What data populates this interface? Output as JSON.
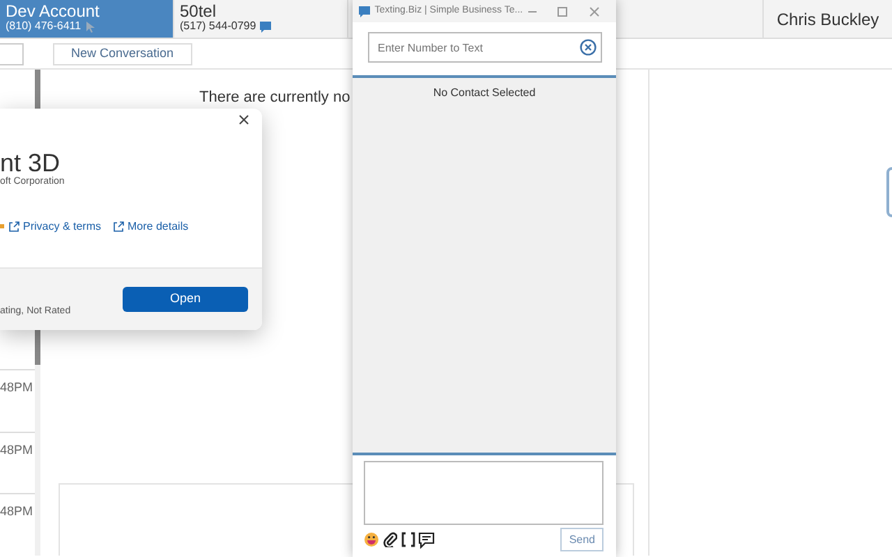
{
  "accounts": [
    {
      "name": "Dev Account",
      "phone": "(810) 476-6411",
      "selected": true
    },
    {
      "name": "50tel",
      "phone": "(517) 544-0799",
      "selected": false
    }
  ],
  "user": {
    "name": "Chris Buckley"
  },
  "toolbar": {
    "new_conversation": "New Conversation"
  },
  "conversation_list": [
    {
      "time": "48PM"
    },
    {
      "time": "48PM"
    },
    {
      "time": "48PM"
    }
  ],
  "empty_message": "There are currently no",
  "app_dialog": {
    "title": "nt 3D",
    "publisher": "oft Corporation",
    "links": [
      "Privacy & terms",
      "More details"
    ],
    "rating": "ating, Not Rated",
    "button": "Open"
  },
  "texting_window": {
    "title": "Texting.Biz | Simple Business Te...",
    "number_field": {
      "placeholder": "Enter Number to Text"
    },
    "status": "No Contact Selected",
    "send_button": "Send"
  }
}
